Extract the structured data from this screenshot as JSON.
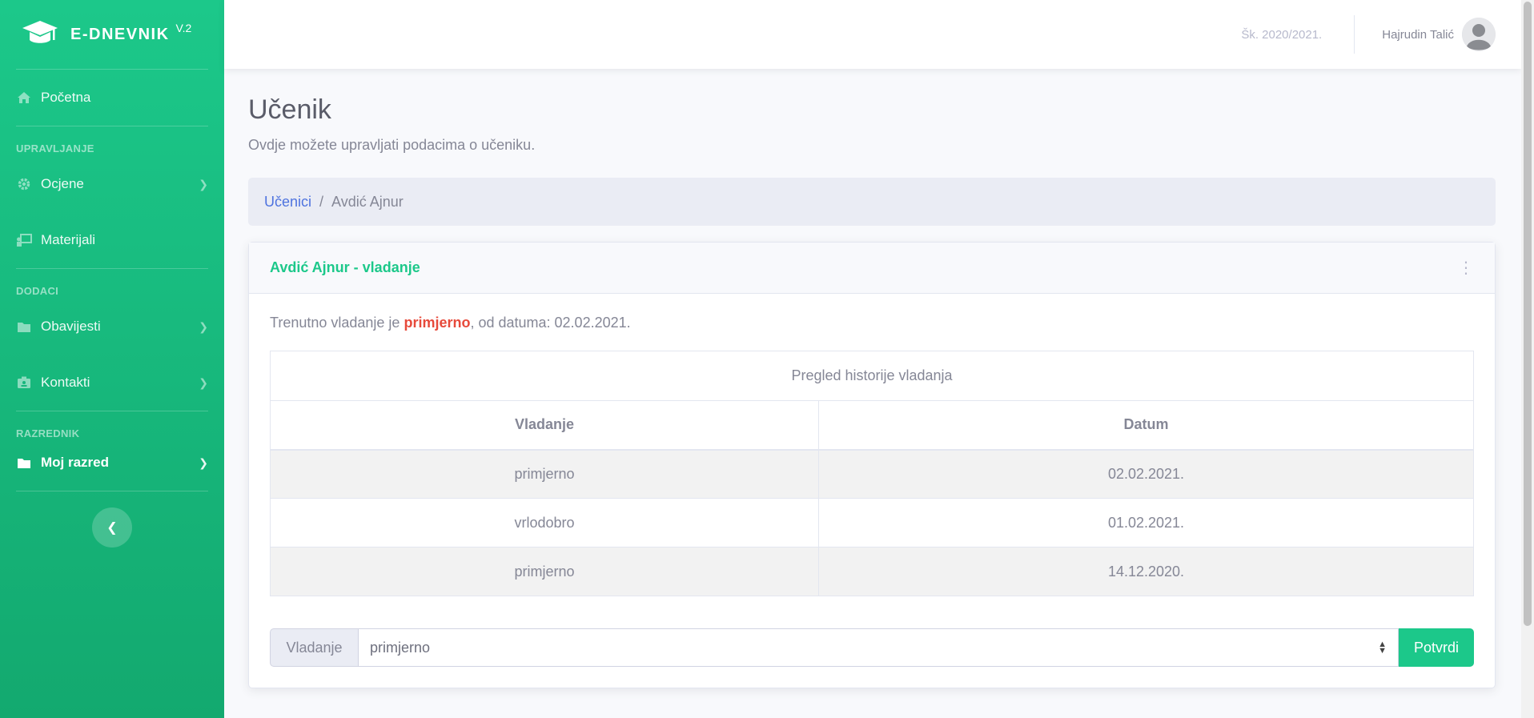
{
  "brand": {
    "name": "E-DNEVNIK",
    "version": "V.2"
  },
  "sidebar": {
    "home": "Početna",
    "heading_manage": "UPRAVLJANJE",
    "grades": "Ocjene",
    "materials": "Materijali",
    "heading_extras": "DODACI",
    "notifications": "Obavijesti",
    "contacts": "Kontakti",
    "heading_class": "RAZREDNIK",
    "my_class": "Moj razred"
  },
  "topbar": {
    "school_year": "Šk. 2020/2021.",
    "user_name": "Hajrudin Talić"
  },
  "page": {
    "title": "Učenik",
    "subtitle": "Ovdje možete upravljati podacima o učeniku."
  },
  "breadcrumb": {
    "parent": "Učenici",
    "separator": "/",
    "current": "Avdić Ajnur"
  },
  "card": {
    "title": "Avdić Ajnur - vladanje",
    "current_prefix": "Trenutno vladanje je ",
    "current_value": "primjerno",
    "current_suffix": ", od datuma: 02.02.2021.",
    "table_caption": "Pregled historije vladanja",
    "col_behaviour": "Vladanje",
    "col_date": "Datum",
    "rows": [
      {
        "behaviour": "primjerno",
        "date": "02.02.2021."
      },
      {
        "behaviour": "vrlodobro",
        "date": "01.02.2021."
      },
      {
        "behaviour": "primjerno",
        "date": "14.12.2020."
      }
    ],
    "form_label": "Vladanje",
    "form_selected": "primjerno",
    "submit": "Potvrdi"
  },
  "colors": {
    "primary_green": "#1cc88a",
    "link_blue": "#4e73df",
    "danger_red": "#e74a3b"
  }
}
